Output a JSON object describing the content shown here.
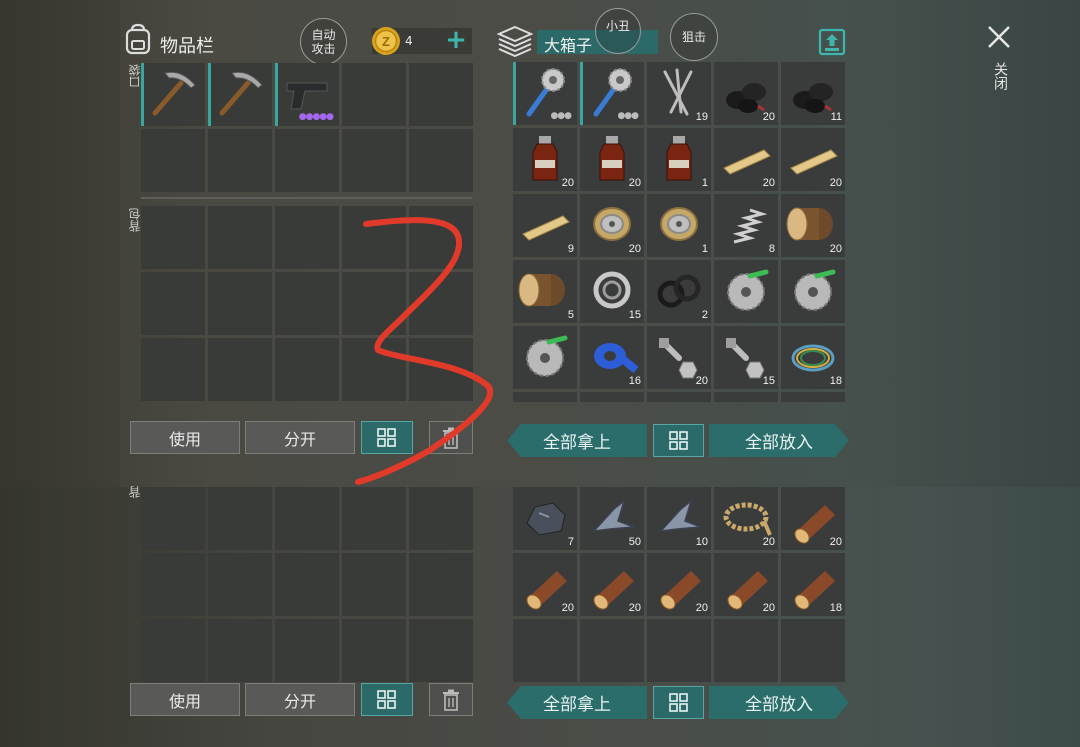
{
  "header": {
    "title": "物品栏",
    "auto_attack": "自动\n攻击",
    "coins": "4",
    "container_name": "大箱子",
    "clown": "小丑",
    "snipe": "狙击",
    "close_label": "关闭"
  },
  "left": {
    "pocket_label": "口袋",
    "backpack_label": "背包",
    "backpack_label_cut": "背",
    "pocket_items": [
      {
        "icon": "pickaxe-icon",
        "qty": "",
        "dots": ""
      },
      {
        "icon": "pickaxe-icon",
        "qty": "",
        "dots": ""
      },
      {
        "icon": "pistol-icon",
        "qty": "",
        "dots": "●●●●●"
      }
    ],
    "buttons": {
      "use": "使用",
      "split": "分开"
    }
  },
  "right": {
    "top_items": [
      {
        "icon": "saw-mace-icon",
        "qty": "",
        "dots": "●●●"
      },
      {
        "icon": "saw-mace-icon",
        "qty": "",
        "dots": "●●●"
      },
      {
        "icon": "nails-icon",
        "qty": "19"
      },
      {
        "icon": "coal-icon",
        "qty": "20"
      },
      {
        "icon": "coal-icon",
        "qty": "11"
      },
      {
        "icon": "bottle-icon",
        "qty": "20"
      },
      {
        "icon": "bottle-icon",
        "qty": "20"
      },
      {
        "icon": "bottle-icon",
        "qty": "1"
      },
      {
        "icon": "plank-icon",
        "qty": "20"
      },
      {
        "icon": "plank-icon",
        "qty": "20"
      },
      {
        "icon": "plank-icon",
        "qty": "9"
      },
      {
        "icon": "wire-spool-icon",
        "qty": "20"
      },
      {
        "icon": "wire-spool-icon",
        "qty": "1"
      },
      {
        "icon": "spring-icon",
        "qty": "8"
      },
      {
        "icon": "log-icon",
        "qty": "20"
      },
      {
        "icon": "log-icon",
        "qty": "5"
      },
      {
        "icon": "bearing-icon",
        "qty": "15"
      },
      {
        "icon": "gasket-icon",
        "qty": "2"
      },
      {
        "icon": "saw-blade-icon",
        "qty": ""
      },
      {
        "icon": "saw-blade-icon",
        "qty": ""
      },
      {
        "icon": "saw-blade-icon",
        "qty": ""
      },
      {
        "icon": "tape-icon",
        "qty": "16"
      },
      {
        "icon": "bolt-icon",
        "qty": "20"
      },
      {
        "icon": "bolt-icon",
        "qty": "15"
      },
      {
        "icon": "cable-icon",
        "qty": "18"
      }
    ],
    "bottom_items": [
      {
        "icon": "ore-icon",
        "qty": "7"
      },
      {
        "icon": "scrap-metal-icon",
        "qty": "50"
      },
      {
        "icon": "scrap-metal-icon",
        "qty": "10"
      },
      {
        "icon": "rope-icon",
        "qty": "20"
      },
      {
        "icon": "wood-log-icon",
        "qty": "20"
      },
      {
        "icon": "wood-log-icon",
        "qty": "20"
      },
      {
        "icon": "wood-log-icon",
        "qty": "20"
      },
      {
        "icon": "wood-log-icon",
        "qty": "20"
      },
      {
        "icon": "wood-log-icon",
        "qty": "20"
      },
      {
        "icon": "wood-log-icon",
        "qty": "18"
      }
    ],
    "buttons": {
      "take_all": "全部拿上",
      "put_all": "全部放入"
    }
  },
  "colors": {
    "accent": "#2a6d6b",
    "annotation": "#e23a2a",
    "slot": "#393b39"
  }
}
